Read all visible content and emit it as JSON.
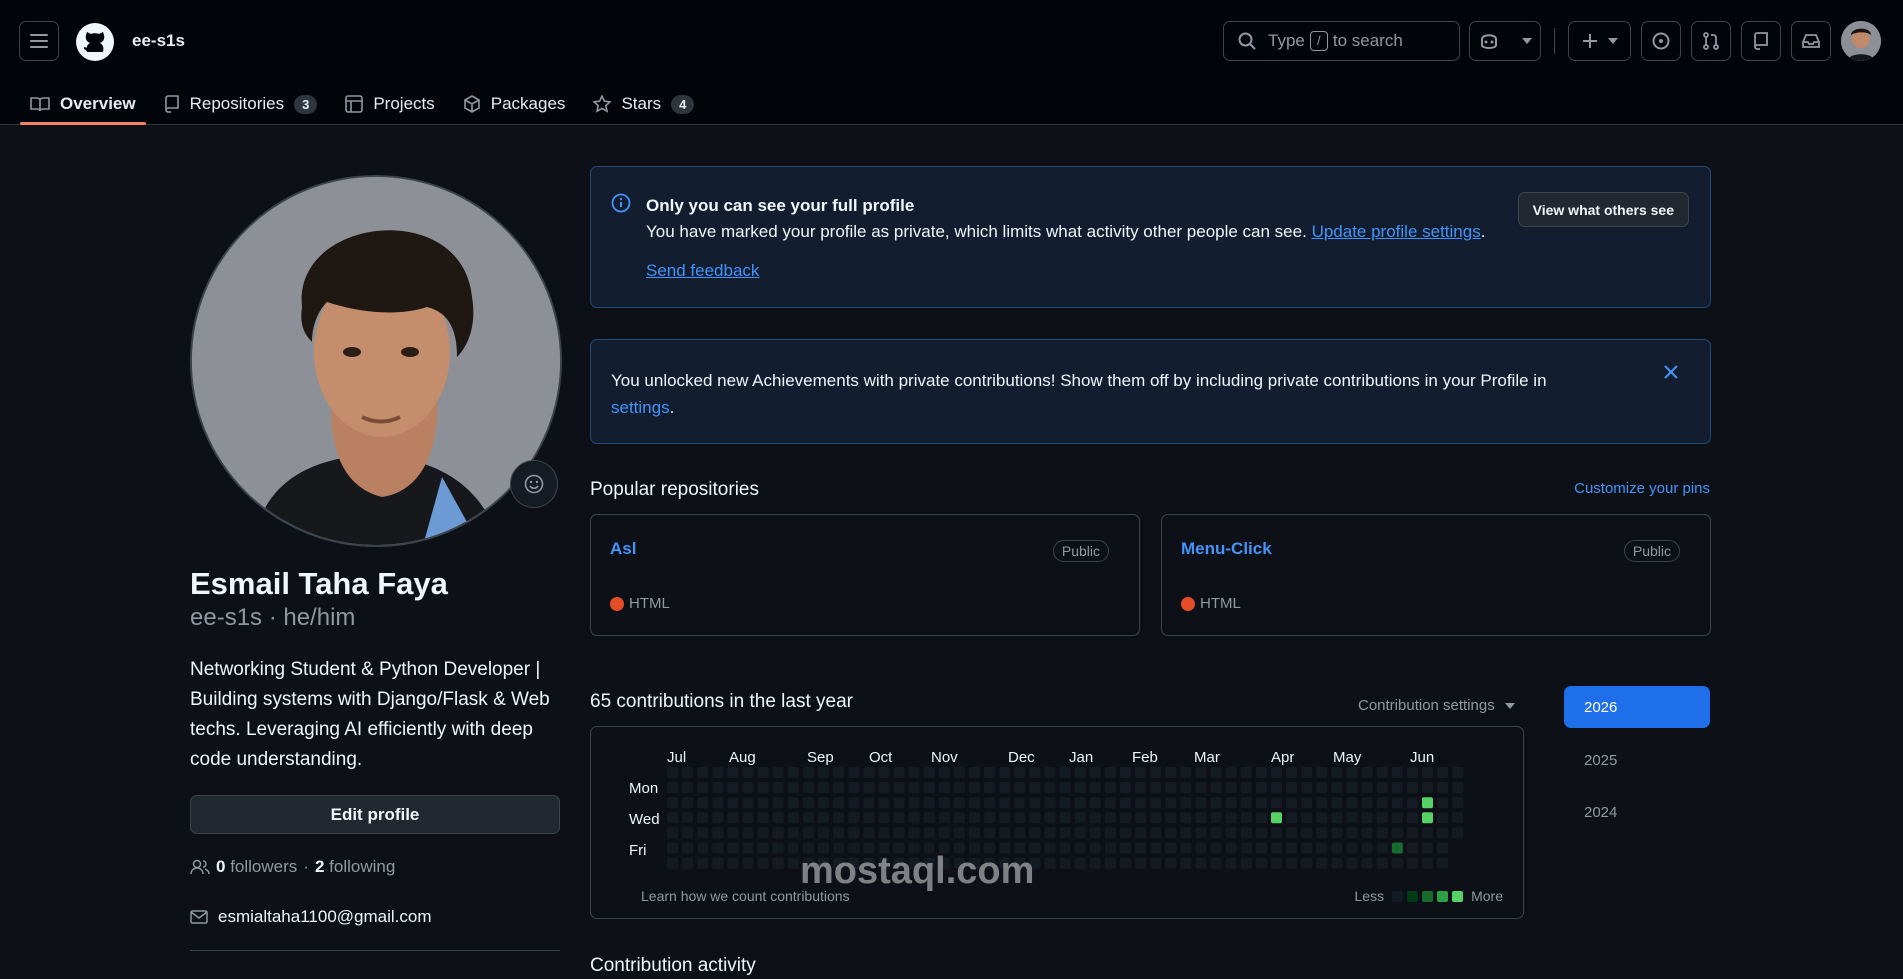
{
  "header": {
    "owner": "ee-s1s",
    "search_pre": "Type",
    "search_key": "/",
    "search_post": "to search"
  },
  "tabs": [
    {
      "label": "Overview",
      "icon": "book-icon"
    },
    {
      "label": "Repositories",
      "count": "3",
      "icon": "repo-icon"
    },
    {
      "label": "Projects",
      "icon": "table-icon"
    },
    {
      "label": "Packages",
      "icon": "package-icon"
    },
    {
      "label": "Stars",
      "count": "4",
      "icon": "star-icon"
    }
  ],
  "profile": {
    "name": "Esmail Taha Faya",
    "login": "ee-s1s · he/him",
    "bio": "Networking Student & Python Developer | Building systems with Django/Flask & Web techs. Leveraging AI efficiently with deep code understanding.",
    "edit_label": "Edit profile",
    "followers_count": "0",
    "followers_label": "followers",
    "following_count": "2",
    "following_label": "following",
    "email": "esmialtaha1100@gmail.com"
  },
  "notice": {
    "title": "Only you can see your full profile",
    "body": "You have marked your profile as private, which limits what activity other people can see.",
    "link": "Update profile settings",
    "feedback": "Send feedback",
    "button": "View what others see"
  },
  "achievement": {
    "text": "You unlocked new Achievements with private contributions! Show them off by including private contributions in your Profile in",
    "link": "settings"
  },
  "popular": {
    "title": "Popular repositories",
    "customize": "Customize your pins",
    "repos": [
      {
        "name": "Asl",
        "visibility": "Public",
        "language": "HTML"
      },
      {
        "name": "Menu-Click",
        "visibility": "Public",
        "language": "HTML"
      }
    ]
  },
  "contributions": {
    "title": "65 contributions in the last year",
    "settings": "Contribution settings",
    "months": [
      "Jul",
      "Aug",
      "Sep",
      "Oct",
      "Nov",
      "Dec",
      "Jan",
      "Feb",
      "Mar",
      "Apr",
      "May",
      "Jun"
    ],
    "days": [
      "Mon",
      "Wed",
      "Fri"
    ],
    "learn": "Learn how we count contributions",
    "less": "Less",
    "more": "More",
    "years": [
      "2026",
      "2025",
      "2024"
    ]
  },
  "activity": {
    "title": "Contribution activity"
  },
  "watermark": "mostaql.com",
  "colors": {
    "accent": "#1f6feb",
    "link": "#4493f8",
    "tab_underline": "#f78166",
    "html_lang": "#e34c26"
  }
}
